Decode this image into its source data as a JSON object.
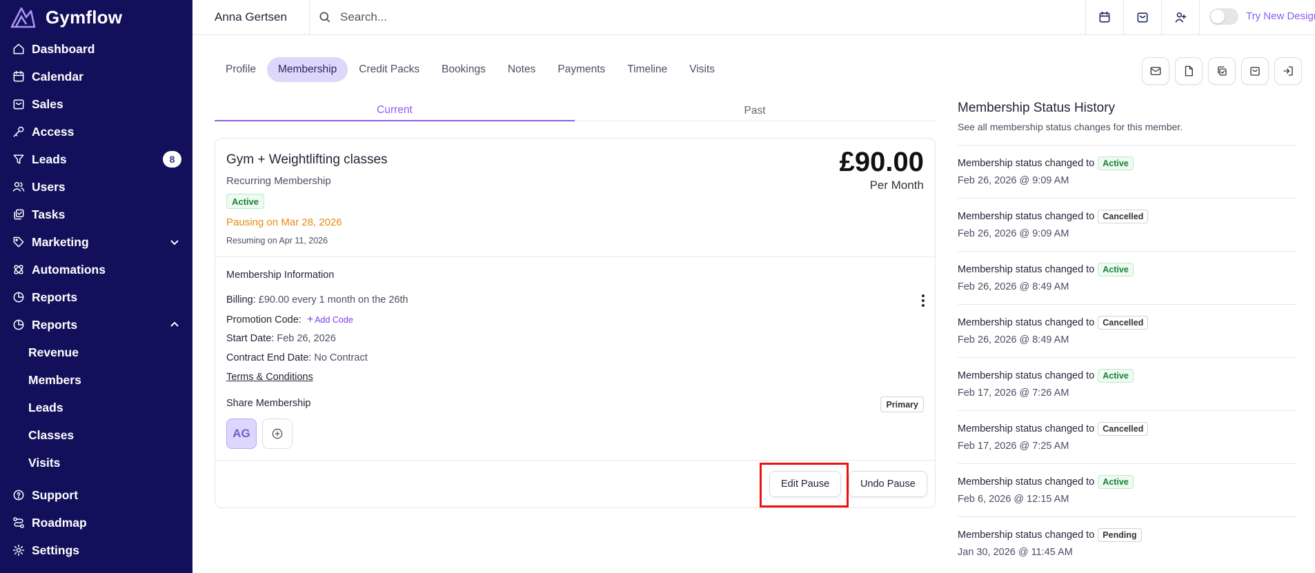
{
  "app": {
    "name": "Gymflow"
  },
  "sidebar": {
    "items": [
      {
        "label": "Dashboard",
        "icon": "home-icon"
      },
      {
        "label": "Calendar",
        "icon": "calendar-icon"
      },
      {
        "label": "Sales",
        "icon": "bag-icon"
      },
      {
        "label": "Access",
        "icon": "key-icon"
      },
      {
        "label": "Leads",
        "icon": "filter-icon",
        "badge": "8"
      },
      {
        "label": "Users",
        "icon": "users-icon"
      },
      {
        "label": "Tasks",
        "icon": "tasks-icon"
      },
      {
        "label": "Marketing",
        "icon": "tag-icon"
      },
      {
        "label": "Automations",
        "icon": "automation-icon"
      },
      {
        "label": "Reports",
        "icon": "pie-chart-icon"
      },
      {
        "label": "Reports",
        "icon": "pie-chart-icon"
      }
    ],
    "sub_items": [
      "Revenue",
      "Members",
      "Leads",
      "Classes",
      "Visits"
    ],
    "bottom_items": [
      {
        "label": "Support",
        "icon": "help-icon"
      },
      {
        "label": "Roadmap",
        "icon": "roadmap-icon"
      },
      {
        "label": "Settings",
        "icon": "gear-icon"
      }
    ]
  },
  "topbar": {
    "user_name": "Anna Gertsen",
    "search_placeholder": "Search...",
    "try_new_design": "Try New Design"
  },
  "tabs": [
    "Profile",
    "Membership",
    "Credit Packs",
    "Bookings",
    "Notes",
    "Payments",
    "Timeline",
    "Visits"
  ],
  "active_tab": "Membership",
  "subtabs": [
    "Current",
    "Past"
  ],
  "membership": {
    "name": "Gym + Weightlifting classes",
    "type": "Recurring Membership",
    "status": "Active",
    "pausing": "Pausing on Mar 28, 2026",
    "resuming": "Resuming on Apr 11, 2026",
    "price": "£90.00",
    "period": "Per Month",
    "info_heading": "Membership Information",
    "billing_label": "Billing:",
    "billing_value": "£90.00 every 1 month on the 26th",
    "promo_label": "Promotion Code:",
    "add_code": "Add Code",
    "start_label": "Start Date:",
    "start_value": "Feb 26, 2026",
    "contract_label": "Contract End Date:",
    "contract_value": "No Contract",
    "terms": "Terms & Conditions",
    "share_heading": "Share Membership",
    "primary": "Primary",
    "avatar_initials": "AG",
    "edit_pause": "Edit Pause",
    "undo_pause": "Undo Pause"
  },
  "history": {
    "title": "Membership Status History",
    "description": "See all membership status changes for this member.",
    "prefix": "Membership status changed to",
    "items": [
      {
        "status": "Active",
        "date": "Feb 26, 2026 @ 9:09 AM"
      },
      {
        "status": "Cancelled",
        "date": "Feb 26, 2026 @ 9:09 AM"
      },
      {
        "status": "Active",
        "date": "Feb 26, 2026 @ 8:49 AM"
      },
      {
        "status": "Cancelled",
        "date": "Feb 26, 2026 @ 8:49 AM"
      },
      {
        "status": "Active",
        "date": "Feb 17, 2026 @ 7:26 AM"
      },
      {
        "status": "Cancelled",
        "date": "Feb 17, 2026 @ 7:25 AM"
      },
      {
        "status": "Active",
        "date": "Feb 6, 2026 @ 12:15 AM"
      },
      {
        "status": "Pending",
        "date": "Jan 30, 2026 @ 11:45 AM"
      }
    ]
  },
  "colors": {
    "sidebar_bg": "#12105a",
    "accent": "#8b5cf6",
    "active_green": "#1a7f3a",
    "pausing_orange": "#e8890f",
    "highlight_red": "#ee1111"
  }
}
